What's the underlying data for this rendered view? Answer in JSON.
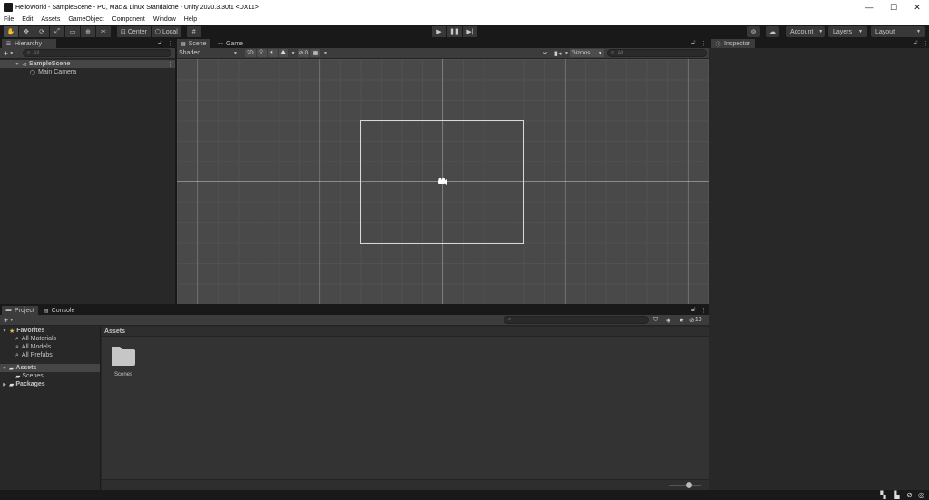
{
  "window": {
    "title": "HelloWorld - SampleScene - PC, Mac & Linux Standalone - Unity 2020.3.30f1 <DX11>",
    "minimize": "—",
    "maximize": "☐",
    "close": "✕"
  },
  "menu": [
    "File",
    "Edit",
    "Assets",
    "GameObject",
    "Component",
    "Window",
    "Help"
  ],
  "toolbar": {
    "pivot_label": "Center",
    "space_label": "Local",
    "account_label": "Account",
    "layers_label": "Layers",
    "layout_label": "Layout"
  },
  "hierarchy": {
    "tab_label": "Hierarchy",
    "search_placeholder": "All",
    "scene_name": "SampleScene",
    "items": [
      "Main Camera"
    ]
  },
  "scene": {
    "tabs": [
      "Scene",
      "Game"
    ],
    "shading_label": "Shaded",
    "mode_2d_label": "2D",
    "hidden_count": "0",
    "gizmos_label": "Gizmos",
    "search_placeholder": "All"
  },
  "inspector": {
    "tab_label": "Inspector"
  },
  "project": {
    "tabs": [
      "Project",
      "Console"
    ],
    "favorites_label": "Favorites",
    "favorites": [
      "All Materials",
      "All Models",
      "All Prefabs"
    ],
    "assets_label": "Assets",
    "scenes_label": "Scenes",
    "packages_label": "Packages",
    "breadcrumb": "Assets",
    "hidden_packages_count": "19",
    "folders": [
      {
        "name": "Scenes"
      }
    ]
  },
  "colors": {
    "background": "#191919",
    "panel": "#282828",
    "scene_bg": "#494949",
    "selection": "#464646",
    "favorite_star": "#e0c042"
  }
}
